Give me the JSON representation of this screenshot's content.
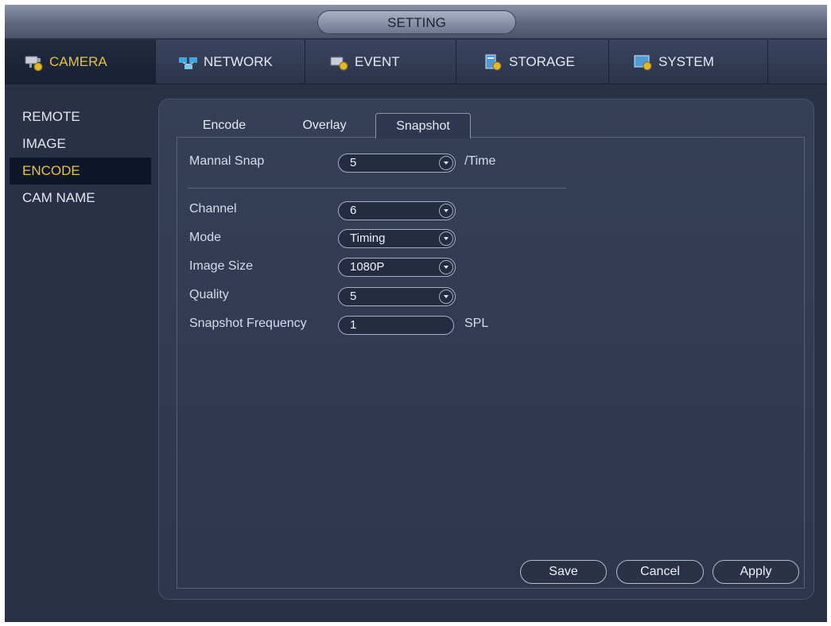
{
  "window": {
    "title": "SETTING"
  },
  "topnav": [
    {
      "label": "CAMERA",
      "icon": "camera-icon",
      "active": true
    },
    {
      "label": "NETWORK",
      "icon": "network-icon"
    },
    {
      "label": "EVENT",
      "icon": "event-icon"
    },
    {
      "label": "STORAGE",
      "icon": "storage-icon"
    },
    {
      "label": "SYSTEM",
      "icon": "system-icon"
    }
  ],
  "sidebar": {
    "items": [
      {
        "label": "REMOTE"
      },
      {
        "label": "IMAGE"
      },
      {
        "label": "ENCODE",
        "active": true
      },
      {
        "label": "CAM NAME"
      }
    ]
  },
  "tabs": [
    {
      "label": "Encode"
    },
    {
      "label": "Overlay"
    },
    {
      "label": "Snapshot",
      "active": true
    }
  ],
  "form": {
    "manual_snap": {
      "label": "Mannal Snap",
      "value": "5",
      "unit": "/Time"
    },
    "channel": {
      "label": "Channel",
      "value": "6"
    },
    "mode": {
      "label": "Mode",
      "value": "Timing"
    },
    "image_size": {
      "label": "Image Size",
      "value": "1080P"
    },
    "quality": {
      "label": "Quality",
      "value": "5"
    },
    "snapshot_frequency": {
      "label": "Snapshot Frequency",
      "value": "1",
      "unit": "SPL"
    }
  },
  "buttons": {
    "save": "Save",
    "cancel": "Cancel",
    "apply": "Apply"
  },
  "colors": {
    "accent": "#e8c23a",
    "background": "#2a3147"
  }
}
